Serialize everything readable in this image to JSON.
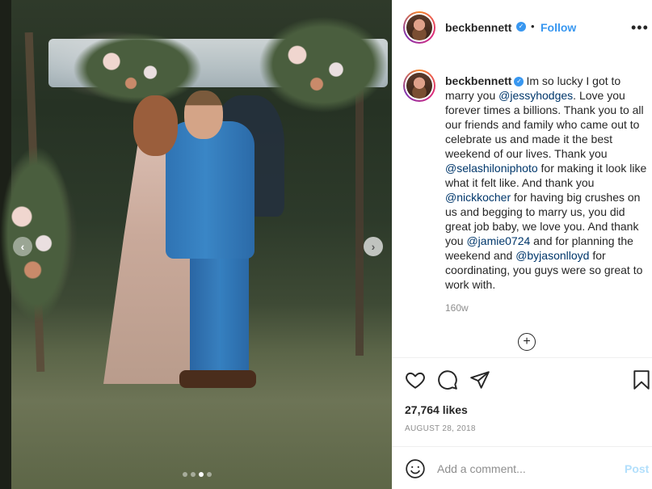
{
  "post": {
    "username": "beckbennett",
    "follow_label": "Follow",
    "separator": "•",
    "more_label": "•••",
    "caption": {
      "username": "beckbennett",
      "segments": {
        "s1": "Im so lucky I got to marry you ",
        "m1": "@jessyhodges",
        "s2": ". Love you forever times a billions. Thank you to all our friends and family who came out to celebrate us and made it the best weekend of our lives. Thank you ",
        "m2": "@selashiloniphoto",
        "s3": " for making it look like what it felt like. And thank you ",
        "m3": "@nickkocher",
        "s4": " for having big crushes on us and begging to marry us, you did great job baby, we love you. And thank you ",
        "m4": "@jamie0724",
        "s5": " and for planning the weekend and ",
        "m5": "@byjasonlloyd",
        "s6": " for coordinating, you guys were so great to work with."
      }
    },
    "time_ago": "160w",
    "likes": "27,764 likes",
    "date": "AUGUST 28, 2018"
  },
  "carousel": {
    "total": 4,
    "active_index": 2,
    "prev_symbol": "‹",
    "next_symbol": "›"
  },
  "comment_box": {
    "placeholder": "Add a comment...",
    "post_label": "Post"
  },
  "icons": {
    "verified": "verified-badge-icon",
    "like": "heart-icon",
    "comment": "comment-bubble-icon",
    "share": "paper-plane-icon",
    "save": "bookmark-icon",
    "emoji": "smiley-icon",
    "load_more": "plus-circle-icon"
  },
  "colors": {
    "link": "#3897f0",
    "mention": "#00376b",
    "muted": "#8e8e8e",
    "post_disabled": "#b2dffc"
  }
}
